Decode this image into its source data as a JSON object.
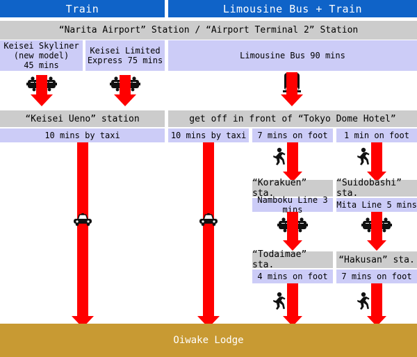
{
  "header": {
    "tabs": [
      {
        "label": "Train"
      },
      {
        "label": "Limousine Bus + Train"
      }
    ]
  },
  "origin": {
    "label": "“Narita Airport” Station /  “Airport Terminal 2” Station"
  },
  "modes_row1": [
    {
      "line1": "Keisei Skyliner",
      "line2": "(new model)",
      "line3": "45 mins",
      "icon": "train-icon"
    },
    {
      "line1": "Keisei Limited",
      "line2": "Express 75 mins",
      "line3": "",
      "icon": "train-icon"
    },
    {
      "line1": "Limousine Bus 90 mins",
      "line2": "",
      "line3": "",
      "icon": "bus-icon"
    }
  ],
  "stations_row1": [
    {
      "label": "“Keisei Ueno” station"
    },
    {
      "label": "get off in front of “Tokyo Dome Hotel”"
    }
  ],
  "legs_row2": [
    {
      "label": "10 mins by taxi",
      "icon": "taxi-icon"
    },
    {
      "label": "10 mins by taxi",
      "icon": "taxi-icon"
    },
    {
      "label": "7 mins on foot",
      "icon": "walk-icon"
    },
    {
      "label": "1 min on foot",
      "icon": "walk-icon"
    }
  ],
  "stations_row2": [
    {
      "label": "“Korakuen” sta."
    },
    {
      "label": "“Suidobashi” sta."
    }
  ],
  "legs_row3": [
    {
      "label": "Namboku Line 3 mins",
      "icon": "train-icon"
    },
    {
      "label": "Mita Line 5 mins",
      "icon": "train-icon"
    }
  ],
  "stations_row3": [
    {
      "label": "“Todaimae” sta."
    },
    {
      "label": "“Hakusan” sta."
    }
  ],
  "legs_row4": [
    {
      "label": "4 mins on foot",
      "icon": "walk-icon"
    },
    {
      "label": "7 mins on foot",
      "icon": "walk-icon"
    }
  ],
  "destination": {
    "label": "Oiwake Lodge"
  },
  "colors": {
    "header_blue": "#0f63c8",
    "station_gray": "#cccccc",
    "mode_lavender": "#ccccf7",
    "arrow_red": "#ff0000",
    "destination_gold": "#c89a33",
    "text_dark": "#000000",
    "text_light": "#ffffff"
  }
}
